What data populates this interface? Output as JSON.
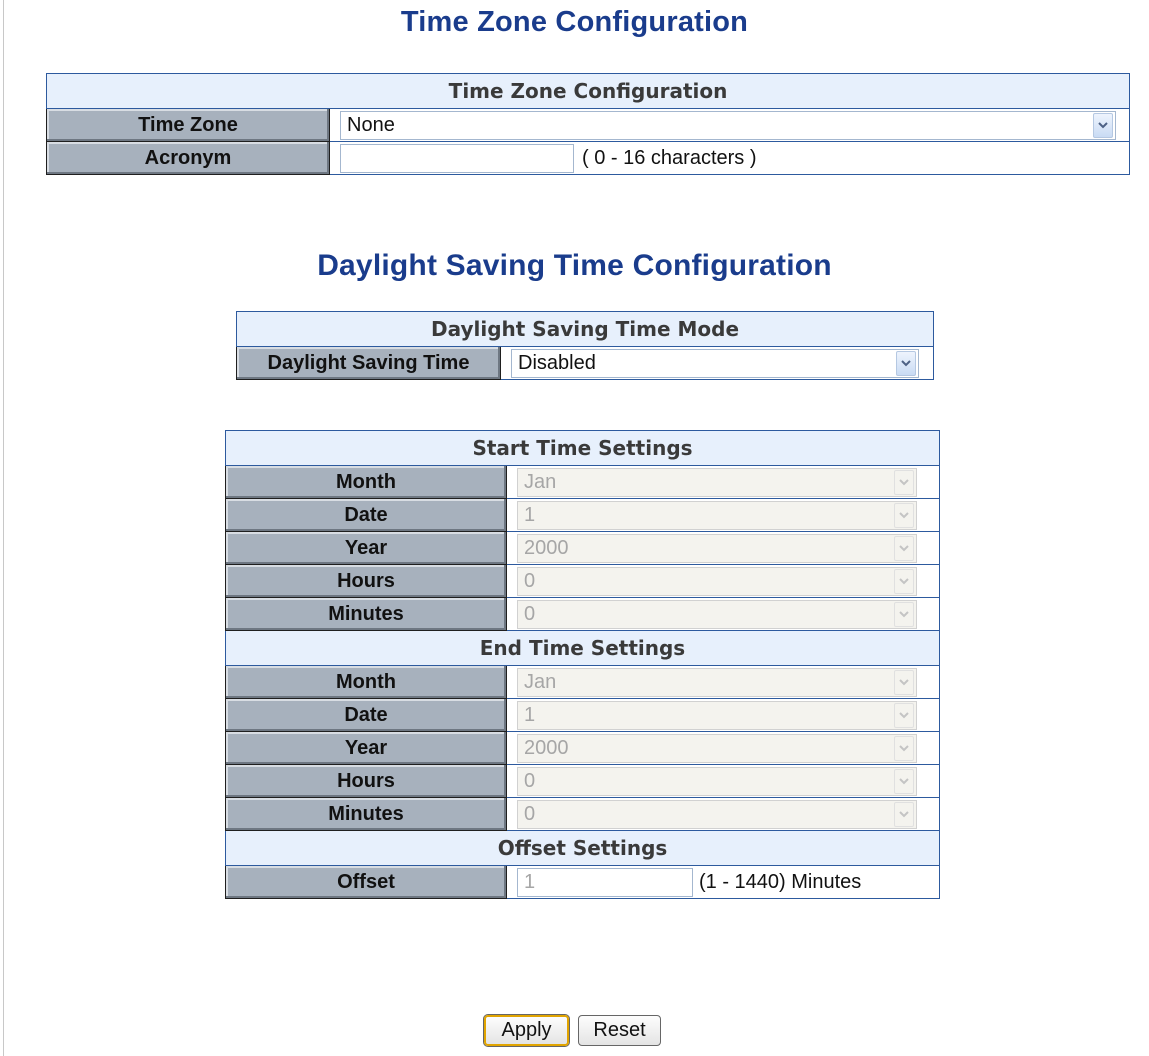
{
  "tz": {
    "title": "Time Zone Configuration",
    "table_header": "Time Zone Configuration",
    "time_zone_label": "Time Zone",
    "time_zone_value": "None",
    "acronym_label": "Acronym",
    "acronym_value": "",
    "acronym_hint": "( 0 - 16 characters )"
  },
  "dst": {
    "title": "Daylight Saving Time Configuration",
    "mode_header": "Daylight Saving Time Mode",
    "mode_label": "Daylight Saving Time",
    "mode_value": "Disabled"
  },
  "start": {
    "header": "Start Time Settings",
    "rows": [
      {
        "label": "Month",
        "value": "Jan"
      },
      {
        "label": "Date",
        "value": "1"
      },
      {
        "label": "Year",
        "value": "2000"
      },
      {
        "label": "Hours",
        "value": "0"
      },
      {
        "label": "Minutes",
        "value": "0"
      }
    ]
  },
  "end": {
    "header": "End Time Settings",
    "rows": [
      {
        "label": "Month",
        "value": "Jan"
      },
      {
        "label": "Date",
        "value": "1"
      },
      {
        "label": "Year",
        "value": "2000"
      },
      {
        "label": "Hours",
        "value": "0"
      },
      {
        "label": "Minutes",
        "value": "0"
      }
    ]
  },
  "offset": {
    "header": "Offset Settings",
    "label": "Offset",
    "value": "1",
    "hint": "(1 - 1440) Minutes"
  },
  "buttons": {
    "apply": "Apply",
    "reset": "Reset"
  },
  "colors": {
    "title": "#1a3c8c",
    "header_bg": "#e7f0fc",
    "label_bg": "#a7b1bd",
    "border": "#2d5a9e"
  }
}
